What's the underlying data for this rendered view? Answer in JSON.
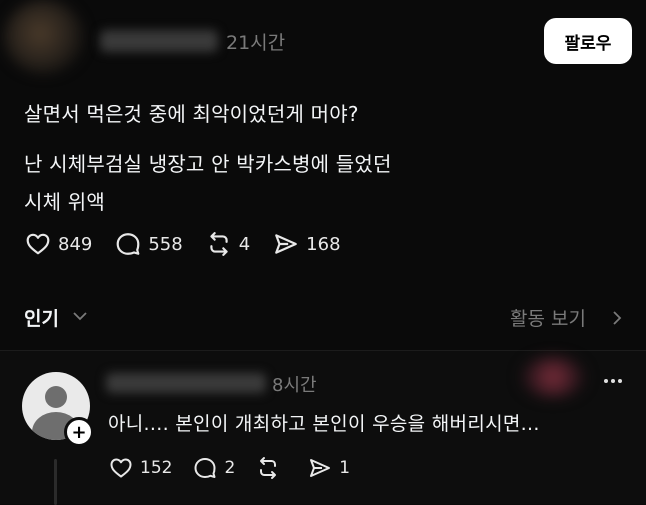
{
  "post": {
    "time": "21시간",
    "follow_label": "팔로우",
    "lines": [
      "살면서 먹은것 중에 최악이었던게 머야?",
      "난 시체부검실 냉장고 안 박카스병에 들었던",
      "시체 위액"
    ],
    "stats": {
      "likes": "849",
      "comments": "558",
      "reposts": "4",
      "shares": "168"
    }
  },
  "sort": {
    "label": "인기",
    "activity_label": "활동 보기"
  },
  "comment": {
    "time": "8시간",
    "text": "아니.... 본인이 개최하고 본인이 우승을 해버리시면...",
    "stats": {
      "likes": "152",
      "comments": "2",
      "reposts": "",
      "shares": "1"
    }
  },
  "icons": [
    "heart-icon",
    "comment-icon",
    "repost-icon",
    "share-icon",
    "chevron-down-icon",
    "chevron-right-icon",
    "more-icon",
    "plus-icon"
  ]
}
